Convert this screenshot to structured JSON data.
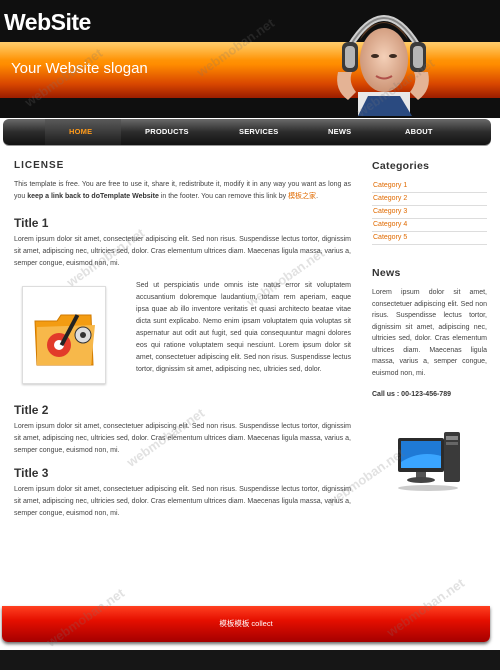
{
  "header": {
    "brand": "WebSite",
    "slogan": "Your Website slogan"
  },
  "nav": {
    "items": [
      {
        "label": "HOME",
        "active": true
      },
      {
        "label": "PRODUCTS",
        "active": false
      },
      {
        "label": "SERVICES",
        "active": false
      },
      {
        "label": "NEWS",
        "active": false
      },
      {
        "label": "ABOUT",
        "active": false
      }
    ]
  },
  "license": {
    "title": "LICENSE",
    "text1": "This template is free. You are free to use it, share it, redistribute it, modify it in any way you want as long as you ",
    "strong": "keep a link back to doTemplate Website",
    "text2": " in the footer. You can remove this link by ",
    "link": "模板之家",
    "text3": "."
  },
  "sections": [
    {
      "title": "Title 1",
      "text": "Lorem ipsum dolor sit amet, consectetuer adipiscing elit. Sed non risus. Suspendisse lectus tortor, dignissim sit amet, adipiscing nec, ultricies sed, dolor. Cras elementum ultrices diam. Maecenas ligula massa, varius a, semper congue, euismod non, mi."
    },
    {
      "title": "Title 2",
      "text": "Lorem ipsum dolor sit amet, consectetuer adipiscing elit. Sed non risus. Suspendisse lectus tortor, dignissim sit amet, adipiscing nec, ultricies sed, dolor. Cras elementum ultrices diam. Maecenas ligula massa, varius a, semper congue, euismod non, mi."
    },
    {
      "title": "Title 3",
      "text": "Lorem ipsum dolor sit amet, consectetuer adipiscing elit. Sed non risus. Suspendisse lectus tortor, dignissim sit amet, adipiscing nec, ultricies sed, dolor. Cras elementum ultrices diam. Maecenas ligula massa, varius a, semper congue, euismod non, mi."
    }
  ],
  "image_block_text": "Sed ut perspiciatis unde omnis iste natus error sit voluptatem accusantium doloremque laudantium, totam rem aperiam, eaque ipsa quae ab illo inventore veritatis et quasi architecto beatae vitae dicta sunt explicabo. Nemo enim ipsam voluptatem quia voluptas sit aspernatur aut odit aut fugit, sed quia consequuntur magni dolores eos qui ratione voluptatem sequi nesciunt. Lorem ipsum dolor sit amet, consectetuer adipiscing elit. Sed non risus. Suspendisse lectus tortor, dignissim sit amet, adipiscing nec, ultricies sed, dolor.",
  "sidebar": {
    "categories_title": "Categories",
    "categories": [
      "Category 1",
      "Category 2",
      "Category 3",
      "Category 4",
      "Category 5"
    ],
    "news_title": "News",
    "news_text": "Lorem ipsum dolor sit amet, consectetuer adipiscing elit. Sed non risus. Suspendisse lectus tortor, dignissim sit amet, adipiscing nec, ultricies sed, dolor. Cras elementum ultrices diam. Maecenas ligula massa, varius a, semper congue, euismod non, mi.",
    "call": "Call us : 00-123-456-789"
  },
  "footer": {
    "text": "模板模板 collect"
  },
  "watermark": "webmoban.net",
  "colors": {
    "accent": "#e06a00",
    "footer": "#e50f00"
  }
}
